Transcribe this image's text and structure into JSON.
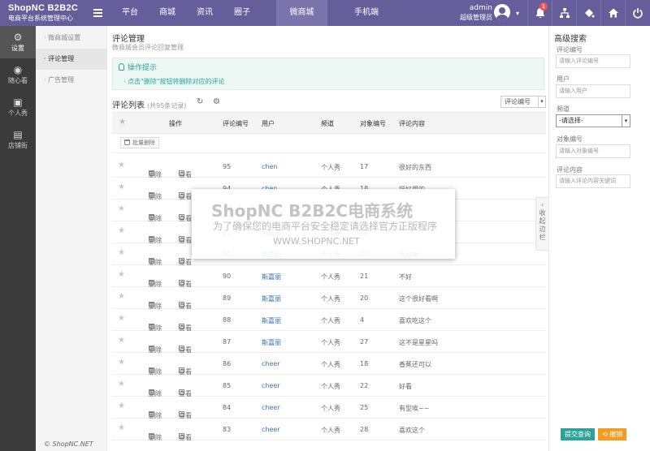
{
  "brand": {
    "title": "ShopNC B2B2C",
    "subtitle": "电商平台系统管理中心"
  },
  "nav": {
    "items": [
      "平台",
      "商城",
      "资讯",
      "圈子",
      "微商城",
      "手机端"
    ],
    "active": "微商城"
  },
  "user": {
    "name": "admin",
    "role": "超级管理员",
    "notification_count": "1"
  },
  "top_icons": [
    "bell-icon",
    "sitemap-icon",
    "paint-icon",
    "home-icon",
    "power-icon"
  ],
  "sidebar": {
    "items": [
      {
        "label": "设置",
        "icon": "gear-icon"
      },
      {
        "label": "随心看",
        "icon": "eye-icon"
      },
      {
        "label": "个人秀",
        "icon": "camera-icon"
      },
      {
        "label": "店铺街",
        "icon": "store-icon"
      }
    ]
  },
  "submenu": {
    "items": [
      "微商城设置",
      "评论管理",
      "广告管理"
    ],
    "active": "评论管理"
  },
  "copyright": "© ShopNC.NET",
  "page": {
    "title": "评论管理",
    "subtitle": "微商城会员评论回复管理",
    "tips_title": "操作提示",
    "tips_text": "· 点击\"删除\"按钮将删除对应的评论",
    "list_title": "评论列表",
    "list_count": "(共95条记录)",
    "filter_select": "评论编号",
    "batch_delete": "批量删除"
  },
  "table": {
    "headers": [
      "操作",
      "评论编号",
      "用户",
      "频道",
      "对象编号",
      "评论内容"
    ],
    "action_delete": "删除",
    "action_view": "查看",
    "rows": [
      {
        "id": "95",
        "user": "chen",
        "channel": "个人秀",
        "obj": "17",
        "content": "很好的东西"
      },
      {
        "id": "94",
        "user": "chen",
        "channel": "个人秀",
        "obj": "18",
        "content": "挺好用的"
      },
      {
        "id": "93",
        "user": "chen",
        "channel": "个人秀",
        "obj": "19",
        "content": ""
      },
      {
        "id": "92",
        "user": "斯嘉丽",
        "channel": "个人秀",
        "obj": "20",
        "content": ""
      },
      {
        "id": "91",
        "user": "斯嘉丽",
        "channel": "个人秀",
        "obj": "21",
        "content": "很好啊"
      },
      {
        "id": "90",
        "user": "斯嘉丽",
        "channel": "个人秀",
        "obj": "21",
        "content": "不好"
      },
      {
        "id": "89",
        "user": "斯嘉丽",
        "channel": "个人秀",
        "obj": "20",
        "content": "这个很好看啊"
      },
      {
        "id": "88",
        "user": "斯嘉丽",
        "channel": "个人秀",
        "obj": "4",
        "content": "喜欢吃这个"
      },
      {
        "id": "87",
        "user": "斯嘉丽",
        "channel": "个人秀",
        "obj": "27",
        "content": "这不是星星吗"
      },
      {
        "id": "86",
        "user": "cheer",
        "channel": "个人秀",
        "obj": "18",
        "content": "香蕉还可以"
      },
      {
        "id": "85",
        "user": "cheer",
        "channel": "个人秀",
        "obj": "22",
        "content": "好看"
      },
      {
        "id": "84",
        "user": "cheer",
        "channel": "个人秀",
        "obj": "25",
        "content": "有型唉~~"
      },
      {
        "id": "83",
        "user": "cheer",
        "channel": "个人秀",
        "obj": "28",
        "content": "喜欢这个"
      }
    ]
  },
  "watermark": {
    "title": "ShopNC B2B2C电商系统",
    "subtitle": "为了确保您的电商平台安全稳定请选择官方正版程序",
    "url": "WWW.SHOPNC.NET"
  },
  "collapse_label": "收起边栏",
  "search": {
    "title": "高级搜索",
    "fields": [
      {
        "label": "评论编号",
        "placeholder": "请输入评论编号"
      },
      {
        "label": "用户",
        "placeholder": "请输入用户"
      },
      {
        "label": "频道",
        "value": "-请选择-"
      },
      {
        "label": "对象编号",
        "placeholder": "请输入对象编号"
      },
      {
        "label": "评论内容",
        "placeholder": "请输入评论内容关键词"
      }
    ],
    "submit": "提交查询",
    "cancel": "撤销"
  },
  "colors": {
    "topbar": "#665e9b",
    "sidebar": "#3b3b3b",
    "accent": "#2ba39b",
    "link": "#3a76b6",
    "cancel": "#f39c1f"
  }
}
